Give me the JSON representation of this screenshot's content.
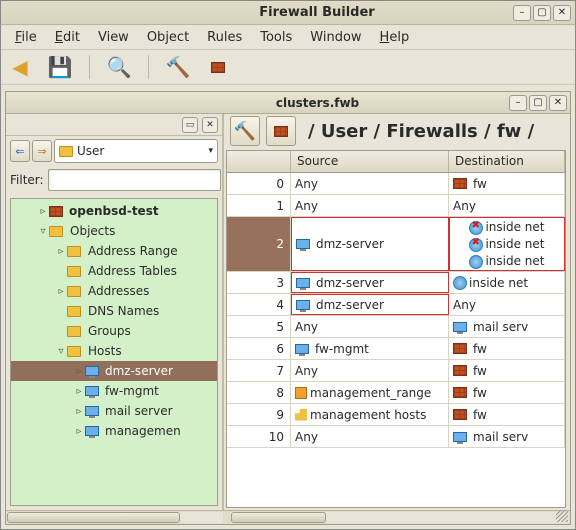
{
  "window": {
    "title": "Firewall Builder"
  },
  "menubar": [
    "File",
    "Edit",
    "View",
    "Object",
    "Rules",
    "Tools",
    "Window",
    "Help"
  ],
  "menubar_underline": [
    0,
    0,
    -1,
    -1,
    -1,
    -1,
    -1,
    0
  ],
  "document": {
    "title": "clusters.fwb"
  },
  "user_combo": "User",
  "filter_label": "Filter:",
  "tree": [
    {
      "depth": 1,
      "exp": "▹",
      "icon": "wall",
      "label": "openbsd-test",
      "bold": true
    },
    {
      "depth": 1,
      "exp": "▿",
      "icon": "folder",
      "label": "Objects"
    },
    {
      "depth": 2,
      "exp": "▹",
      "icon": "folder",
      "label": "Address Range"
    },
    {
      "depth": 2,
      "exp": "",
      "icon": "folder",
      "label": "Address Tables"
    },
    {
      "depth": 2,
      "exp": "▹",
      "icon": "folder",
      "label": "Addresses"
    },
    {
      "depth": 2,
      "exp": "",
      "icon": "folder",
      "label": "DNS Names"
    },
    {
      "depth": 2,
      "exp": "",
      "icon": "folder",
      "label": "Groups"
    },
    {
      "depth": 2,
      "exp": "▿",
      "icon": "folder",
      "label": "Hosts"
    },
    {
      "depth": 3,
      "exp": "▹",
      "icon": "pc",
      "label": "dmz-server",
      "selected": true
    },
    {
      "depth": 3,
      "exp": "▹",
      "icon": "pc",
      "label": "fw-mgmt"
    },
    {
      "depth": 3,
      "exp": "▹",
      "icon": "pc",
      "label": "mail server"
    },
    {
      "depth": 3,
      "exp": "▹",
      "icon": "pc",
      "label": "managemen"
    }
  ],
  "breadcrumb": "/ User / Firewalls / fw /",
  "columns": {
    "num": "",
    "src": "Source",
    "dst": "Destination"
  },
  "rules": [
    {
      "n": 0,
      "src": [
        {
          "t": "Any"
        }
      ],
      "dst": [
        {
          "i": "wall",
          "t": "fw"
        }
      ]
    },
    {
      "n": 1,
      "src": [
        {
          "t": "Any"
        }
      ],
      "dst": [
        {
          "t": "Any"
        }
      ]
    },
    {
      "n": 2,
      "sel": true,
      "src_red": true,
      "dst_red": true,
      "src": [
        {
          "i": "pc",
          "t": "dmz-server"
        }
      ],
      "dst": [
        {
          "i": "netx",
          "t": "inside net"
        },
        {
          "i": "netx",
          "t": "inside net"
        },
        {
          "i": "net",
          "t": "inside net"
        }
      ]
    },
    {
      "n": 3,
      "src_red": true,
      "src": [
        {
          "i": "pc",
          "t": "dmz-server"
        }
      ],
      "dst": [
        {
          "i": "net",
          "t": "inside net"
        }
      ]
    },
    {
      "n": 4,
      "src_red": true,
      "src": [
        {
          "i": "pc",
          "t": "dmz-server"
        }
      ],
      "dst": [
        {
          "t": "Any"
        }
      ]
    },
    {
      "n": 5,
      "src": [
        {
          "t": "Any"
        }
      ],
      "dst": [
        {
          "i": "pc",
          "t": "mail serv"
        }
      ]
    },
    {
      "n": 6,
      "src": [
        {
          "i": "pc",
          "t": "fw-mgmt"
        }
      ],
      "dst": [
        {
          "i": "wall",
          "t": "fw"
        }
      ]
    },
    {
      "n": 7,
      "src": [
        {
          "t": "Any"
        }
      ],
      "dst": [
        {
          "i": "wall",
          "t": "fw"
        }
      ]
    },
    {
      "n": 8,
      "src": [
        {
          "i": "addr",
          "t": "management_range"
        }
      ],
      "dst": [
        {
          "i": "wall",
          "t": "fw"
        }
      ]
    },
    {
      "n": 9,
      "src": [
        {
          "i": "grp",
          "t": "management hosts"
        }
      ],
      "dst": [
        {
          "i": "wall",
          "t": "fw"
        }
      ]
    },
    {
      "n": 10,
      "src": [
        {
          "t": "Any"
        }
      ],
      "dst": [
        {
          "i": "pc",
          "t": "mail serv"
        }
      ]
    }
  ]
}
